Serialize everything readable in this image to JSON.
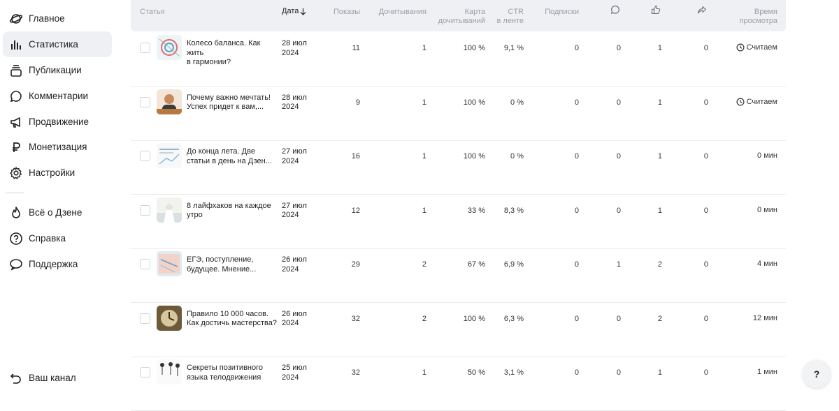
{
  "sidebar": {
    "items": [
      {
        "label": "Главное",
        "icon": "planet-icon"
      },
      {
        "label": "Статистика",
        "icon": "bar-chart-icon"
      },
      {
        "label": "Публикации",
        "icon": "stack-icon"
      },
      {
        "label": "Комментарии",
        "icon": "comment-icon"
      },
      {
        "label": "Продвижение",
        "icon": "megaphone-icon"
      },
      {
        "label": "Монетизация",
        "icon": "ruble-icon"
      },
      {
        "label": "Настройки",
        "icon": "gear-icon"
      }
    ],
    "secondary": [
      {
        "label": "Всё о Дзене",
        "icon": "flame-icon"
      },
      {
        "label": "Справка",
        "icon": "question-icon"
      },
      {
        "label": "Поддержка",
        "icon": "support-chat-icon"
      }
    ],
    "bottom": {
      "label": "Ваш канал",
      "icon": "back-arrow-icon"
    }
  },
  "table": {
    "headers": {
      "article": "Статья",
      "date": "Дата",
      "date_sort_icon": "arrow-down-icon",
      "views": "Показы",
      "reads": "Дочитывания",
      "read_map_1": "Карта",
      "read_map_2": "дочитываний",
      "ctr_1": "CTR",
      "ctr_2": "в ленте",
      "subs": "Подписки",
      "comments_icon": "comment-icon",
      "likes_icon": "thumbs-up-icon",
      "shares_icon": "share-arrow-icon",
      "time_1": "Время",
      "time_2": "просмотра"
    },
    "rows": [
      {
        "title_1": "Колесо баланса. Как жить",
        "title_2": "в гармонии?",
        "date_1": "28 июл",
        "date_2": "2024",
        "views": "11",
        "reads": "1",
        "read_map": "100 %",
        "ctr": "9,1 %",
        "subs": "0",
        "comments": "0",
        "likes": "1",
        "shares": "0",
        "time": "Считаем",
        "time_icon": "clock-icon"
      },
      {
        "title_1": "Почему важно мечтать!",
        "title_2": "Успех придет к вам,...",
        "date_1": "28 июл",
        "date_2": "2024",
        "views": "9",
        "reads": "1",
        "read_map": "100 %",
        "ctr": "0 %",
        "subs": "0",
        "comments": "0",
        "likes": "1",
        "shares": "0",
        "time": "Считаем",
        "time_icon": "clock-icon"
      },
      {
        "title_1": "До конца лета. Две",
        "title_2": "статьи в день на Дзен...",
        "date_1": "27 июл",
        "date_2": "2024",
        "views": "16",
        "reads": "1",
        "read_map": "100 %",
        "ctr": "0 %",
        "subs": "0",
        "comments": "0",
        "likes": "1",
        "shares": "0",
        "time": "0 мин",
        "time_icon": ""
      },
      {
        "title_1": "8 лайфхаков на каждое",
        "title_2": "утро",
        "date_1": "27 июл",
        "date_2": "2024",
        "views": "12",
        "reads": "1",
        "read_map": "33 %",
        "ctr": "8,3 %",
        "subs": "0",
        "comments": "0",
        "likes": "1",
        "shares": "0",
        "time": "0 мин",
        "time_icon": ""
      },
      {
        "title_1": "ЕГЭ, поступление,",
        "title_2": "будущее. Мнение...",
        "date_1": "26 июл",
        "date_2": "2024",
        "views": "29",
        "reads": "2",
        "read_map": "67 %",
        "ctr": "6,9 %",
        "subs": "0",
        "comments": "1",
        "likes": "2",
        "shares": "0",
        "time": "4 мин",
        "time_icon": ""
      },
      {
        "title_1": "Правило 10 000 часов.",
        "title_2": "Как достичь мастерства?",
        "date_1": "26 июл",
        "date_2": "2024",
        "views": "32",
        "reads": "2",
        "read_map": "100 %",
        "ctr": "6,3 %",
        "subs": "0",
        "comments": "0",
        "likes": "2",
        "shares": "0",
        "time": "12 мин",
        "time_icon": ""
      },
      {
        "title_1": "Секреты позитивного",
        "title_2": "языка телодвижения",
        "date_1": "25 июл",
        "date_2": "2024",
        "views": "32",
        "reads": "1",
        "read_map": "50 %",
        "ctr": "3,1 %",
        "subs": "0",
        "comments": "0",
        "likes": "1",
        "shares": "0",
        "time": "1 мин",
        "time_icon": ""
      }
    ]
  },
  "help_button": "?"
}
